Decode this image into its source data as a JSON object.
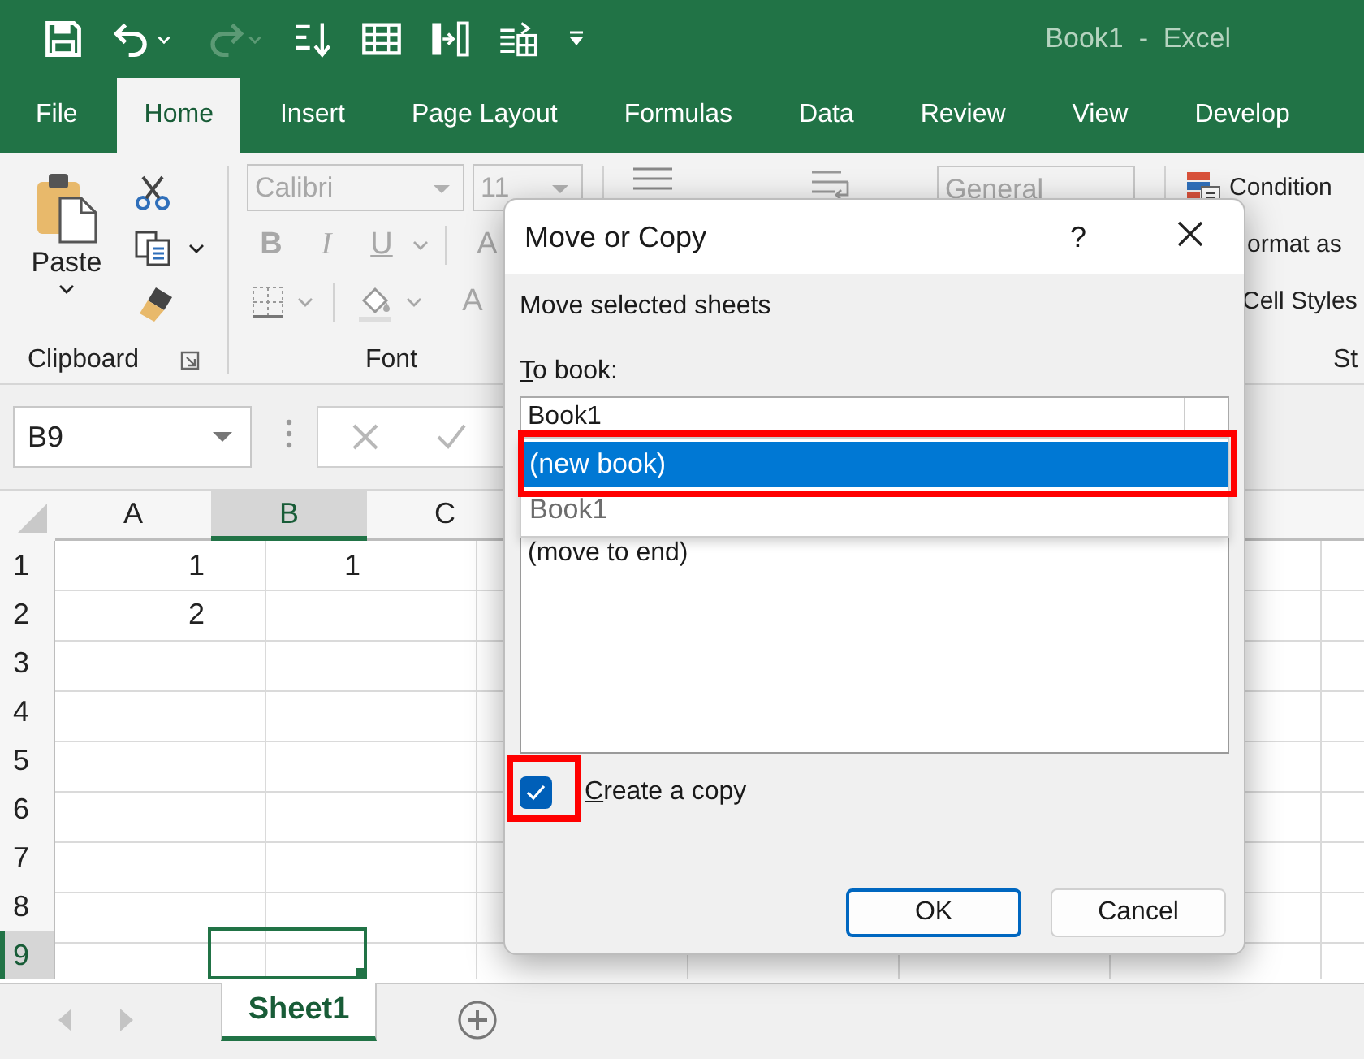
{
  "title_bar": {
    "title": "Book1  -  Excel",
    "quick_access": [
      {
        "kind": "save",
        "disabled": false
      },
      {
        "kind": "undo",
        "disabled": false
      },
      {
        "kind": "redo",
        "disabled": true
      },
      {
        "kind": "sort",
        "disabled": false
      },
      {
        "kind": "table",
        "disabled": false
      },
      {
        "kind": "split",
        "disabled": false
      },
      {
        "kind": "calc",
        "disabled": false
      },
      {
        "kind": "customize",
        "disabled": false
      }
    ]
  },
  "ribbon_tabs": [
    {
      "label": "File",
      "selected": false
    },
    {
      "label": "Home",
      "selected": true
    },
    {
      "label": "Insert",
      "selected": false
    },
    {
      "label": "Page Layout",
      "selected": false
    },
    {
      "label": "Formulas",
      "selected": false
    },
    {
      "label": "Data",
      "selected": false
    },
    {
      "label": "Review",
      "selected": false
    },
    {
      "label": "View",
      "selected": false
    },
    {
      "label": "Develop",
      "selected": false
    }
  ],
  "ribbon": {
    "clipboard": {
      "paste": "Paste",
      "label": "Clipboard"
    },
    "font": {
      "disabled": true,
      "font_name": "Calibri",
      "font_size": "11",
      "format_buttons": [
        "B",
        "I",
        "U"
      ],
      "grow_font": "A",
      "font_color": "A",
      "label": "Font"
    },
    "number_format": {
      "value": "General",
      "disabled": true
    },
    "styles": {
      "items": [
        "Condition",
        "ormat as",
        "Cell Styles"
      ],
      "label": "St"
    }
  },
  "formula_bar": {
    "name_box": "B9"
  },
  "sheet": {
    "columns": [
      {
        "label": "A",
        "selected": false
      },
      {
        "label": "B",
        "selected": true
      },
      {
        "label": "C",
        "selected": false
      }
    ],
    "rows": [
      {
        "header": "1",
        "selected": false,
        "cells": [
          "1",
          "1"
        ]
      },
      {
        "header": "2",
        "selected": false,
        "cells": [
          "2"
        ]
      },
      {
        "header": "3",
        "selected": false
      },
      {
        "header": "4",
        "selected": false
      },
      {
        "header": "5",
        "selected": false
      },
      {
        "header": "6",
        "selected": false
      },
      {
        "header": "7",
        "selected": false
      },
      {
        "header": "8",
        "selected": false
      },
      {
        "header": "9",
        "selected": true
      }
    ]
  },
  "sheet_tabs": [
    {
      "label": "Sheet1",
      "selected": true
    }
  ],
  "dialog": {
    "title": "Move or Copy",
    "help": "?",
    "heading": "Move selected sheets",
    "to_book_label": "To book:",
    "to_book_value": "Book1",
    "dropdown_options": [
      {
        "label": "(new book)",
        "selected": true,
        "highlighted": true
      },
      {
        "label": "Book1",
        "selected": false,
        "highlighted": false
      }
    ],
    "before_sheet_items": [
      "(move to end)"
    ],
    "create_copy": {
      "label": "Create a copy",
      "checked": true,
      "highlighted": true
    },
    "buttons": [
      {
        "label": "OK",
        "default": true
      },
      {
        "label": "Cancel",
        "default": false
      }
    ]
  }
}
